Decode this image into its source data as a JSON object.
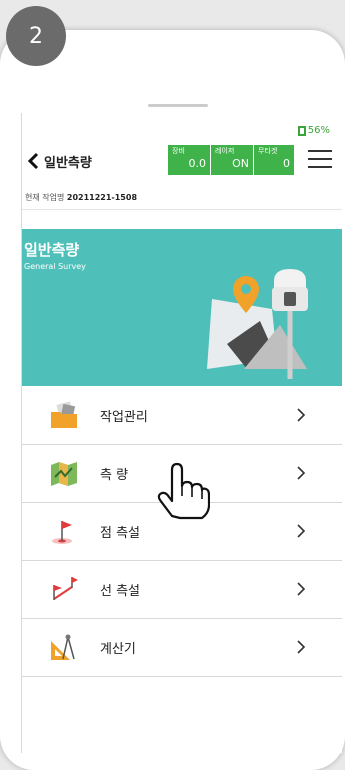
{
  "step_number": "2",
  "status_bar": {
    "battery": "56%"
  },
  "header": {
    "title": "일반측량",
    "stats": [
      {
        "label": "장비",
        "value": "0.0"
      },
      {
        "label": "레이저",
        "value": "ON"
      },
      {
        "label": "무타겟",
        "value": "0"
      }
    ]
  },
  "job": {
    "label": "현재 작업명",
    "name": "20211221-1508"
  },
  "banner": {
    "title": "일반측량",
    "subtitle": "General Survey"
  },
  "menu": [
    {
      "label": "작업관리",
      "icon": "folder-icon"
    },
    {
      "label": "측 량",
      "icon": "map-icon"
    },
    {
      "label": "점 측설",
      "icon": "flag-icon"
    },
    {
      "label": "선 측설",
      "icon": "flags-icon"
    },
    {
      "label": "계산기",
      "icon": "compass-icon"
    }
  ],
  "colors": {
    "accent_green": "#3fb24a",
    "banner_teal": "#4fc0b9",
    "pin_orange": "#f0a22a"
  }
}
